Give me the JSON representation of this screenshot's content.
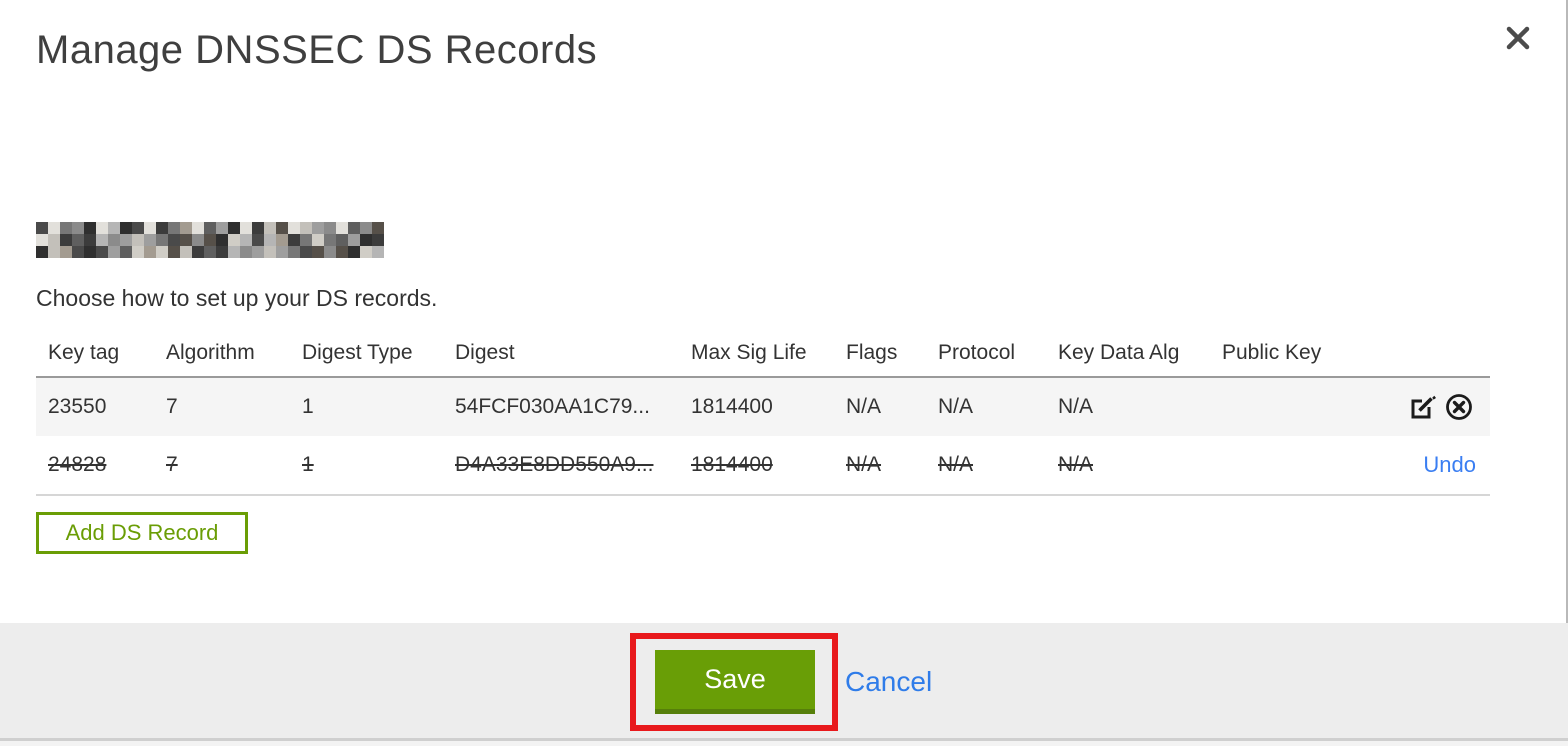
{
  "modal": {
    "title": "Manage DNSSEC DS Records",
    "domain": {
      "redacted": true
    },
    "instruction": "Choose how to set up your DS records.",
    "table": {
      "columns": [
        "Key tag",
        "Algorithm",
        "Digest Type",
        "Digest",
        "Max Sig Life",
        "Flags",
        "Protocol",
        "Key Data Alg",
        "Public Key"
      ],
      "rows": [
        {
          "state": "active",
          "cells": [
            "23550",
            "7",
            "1",
            "54FCF030AA1C79...",
            "1814400",
            "N/A",
            "N/A",
            "N/A",
            ""
          ],
          "actions": [
            "edit",
            "delete"
          ]
        },
        {
          "state": "deleted",
          "cells": [
            "24828",
            "7",
            "1",
            "D4A33E8DD550A9...",
            "1814400",
            "N/A",
            "N/A",
            "N/A",
            ""
          ],
          "undo_label": "Undo"
        }
      ]
    },
    "add_button_label": "Add DS Record",
    "footer": {
      "save_label": "Save",
      "cancel_label": "Cancel"
    }
  },
  "colors": {
    "green_accent": "#6a9d05",
    "save_green": "#699e06",
    "link_blue": "#3a7ef2",
    "annotation_red": "#e8191c",
    "footer_gray": "#ededed",
    "row_gray": "#f5f5f5"
  },
  "icons": {
    "close": "close-icon",
    "edit": "edit-icon",
    "delete": "delete-circle-icon"
  }
}
